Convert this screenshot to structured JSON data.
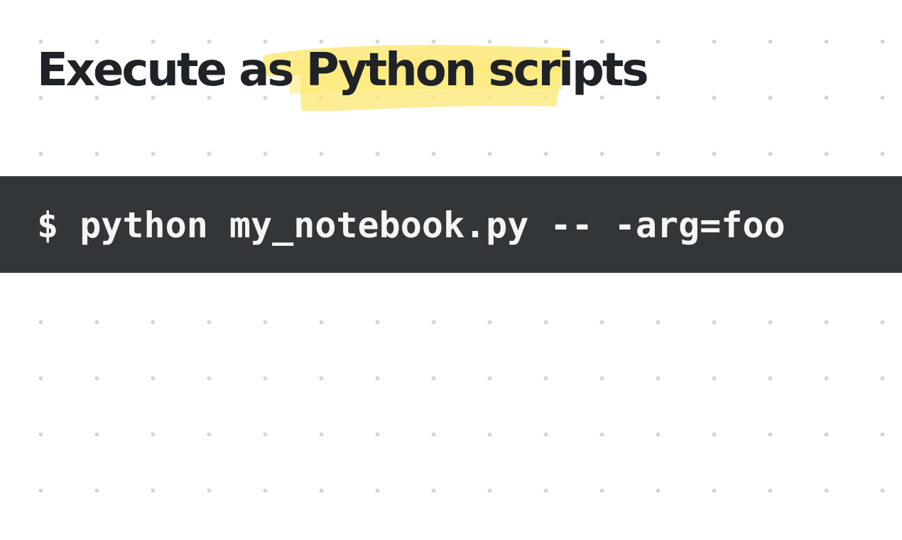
{
  "slide": {
    "title": "Execute as Python scripts",
    "command": "$ python my_notebook.py -- -arg=foo"
  },
  "colors": {
    "background": "#ffffff",
    "dot_grid": "#d4d4d4",
    "title_text": "#1f2226",
    "highlight": "#fde97a",
    "terminal_background": "#333638",
    "terminal_text": "#f5f5f5"
  }
}
